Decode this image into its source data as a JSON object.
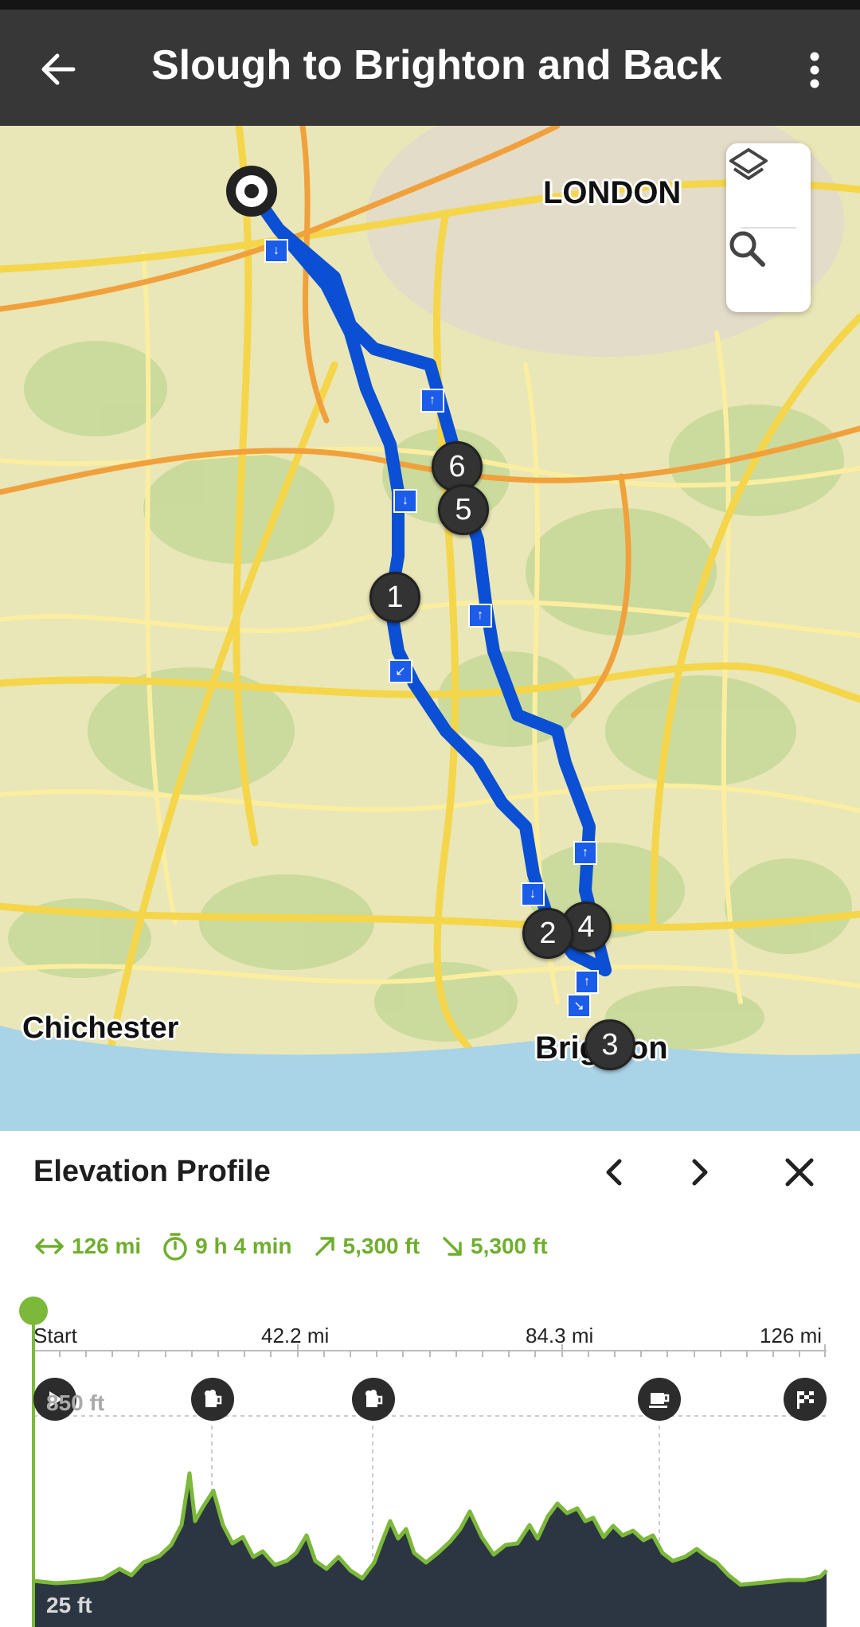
{
  "app_bar": {
    "title": "Slough to Brighton and Back",
    "back_icon": "arrow-left-icon",
    "menu_icon": "more-vertical-icon"
  },
  "map": {
    "labels": {
      "london": "LONDON",
      "chichester": "Chichester",
      "brighton": "Brighton"
    },
    "waypoints": [
      "1",
      "2",
      "3",
      "4",
      "5",
      "6"
    ],
    "controls": {
      "layers_icon": "layers-icon",
      "search_icon": "search-icon"
    },
    "colors": {
      "route": "#0a4fd4",
      "land": "#e9e6b7",
      "forest": "#c7d99a",
      "sea": "#a9d3e6",
      "road": "#f5d64a"
    }
  },
  "panel": {
    "heading": "Elevation Profile",
    "prev_icon": "chevron-left-icon",
    "next_icon": "chevron-right-icon",
    "close_icon": "close-icon"
  },
  "stats": {
    "distance": "126 mi",
    "duration": "9 h 4 min",
    "ascent": "5,300 ft",
    "descent": "5,300 ft",
    "accent_color": "#6fae2d"
  },
  "profile": {
    "x_labels": [
      "Start",
      "42.2 mi",
      "84.3 mi",
      "126 mi"
    ],
    "elevation_max": "850 ft",
    "elevation_min": "25 ft",
    "poi_icons": [
      "play-icon",
      "beer-icon",
      "beer-icon",
      "coffee-icon",
      "finish-flag-icon"
    ]
  }
}
